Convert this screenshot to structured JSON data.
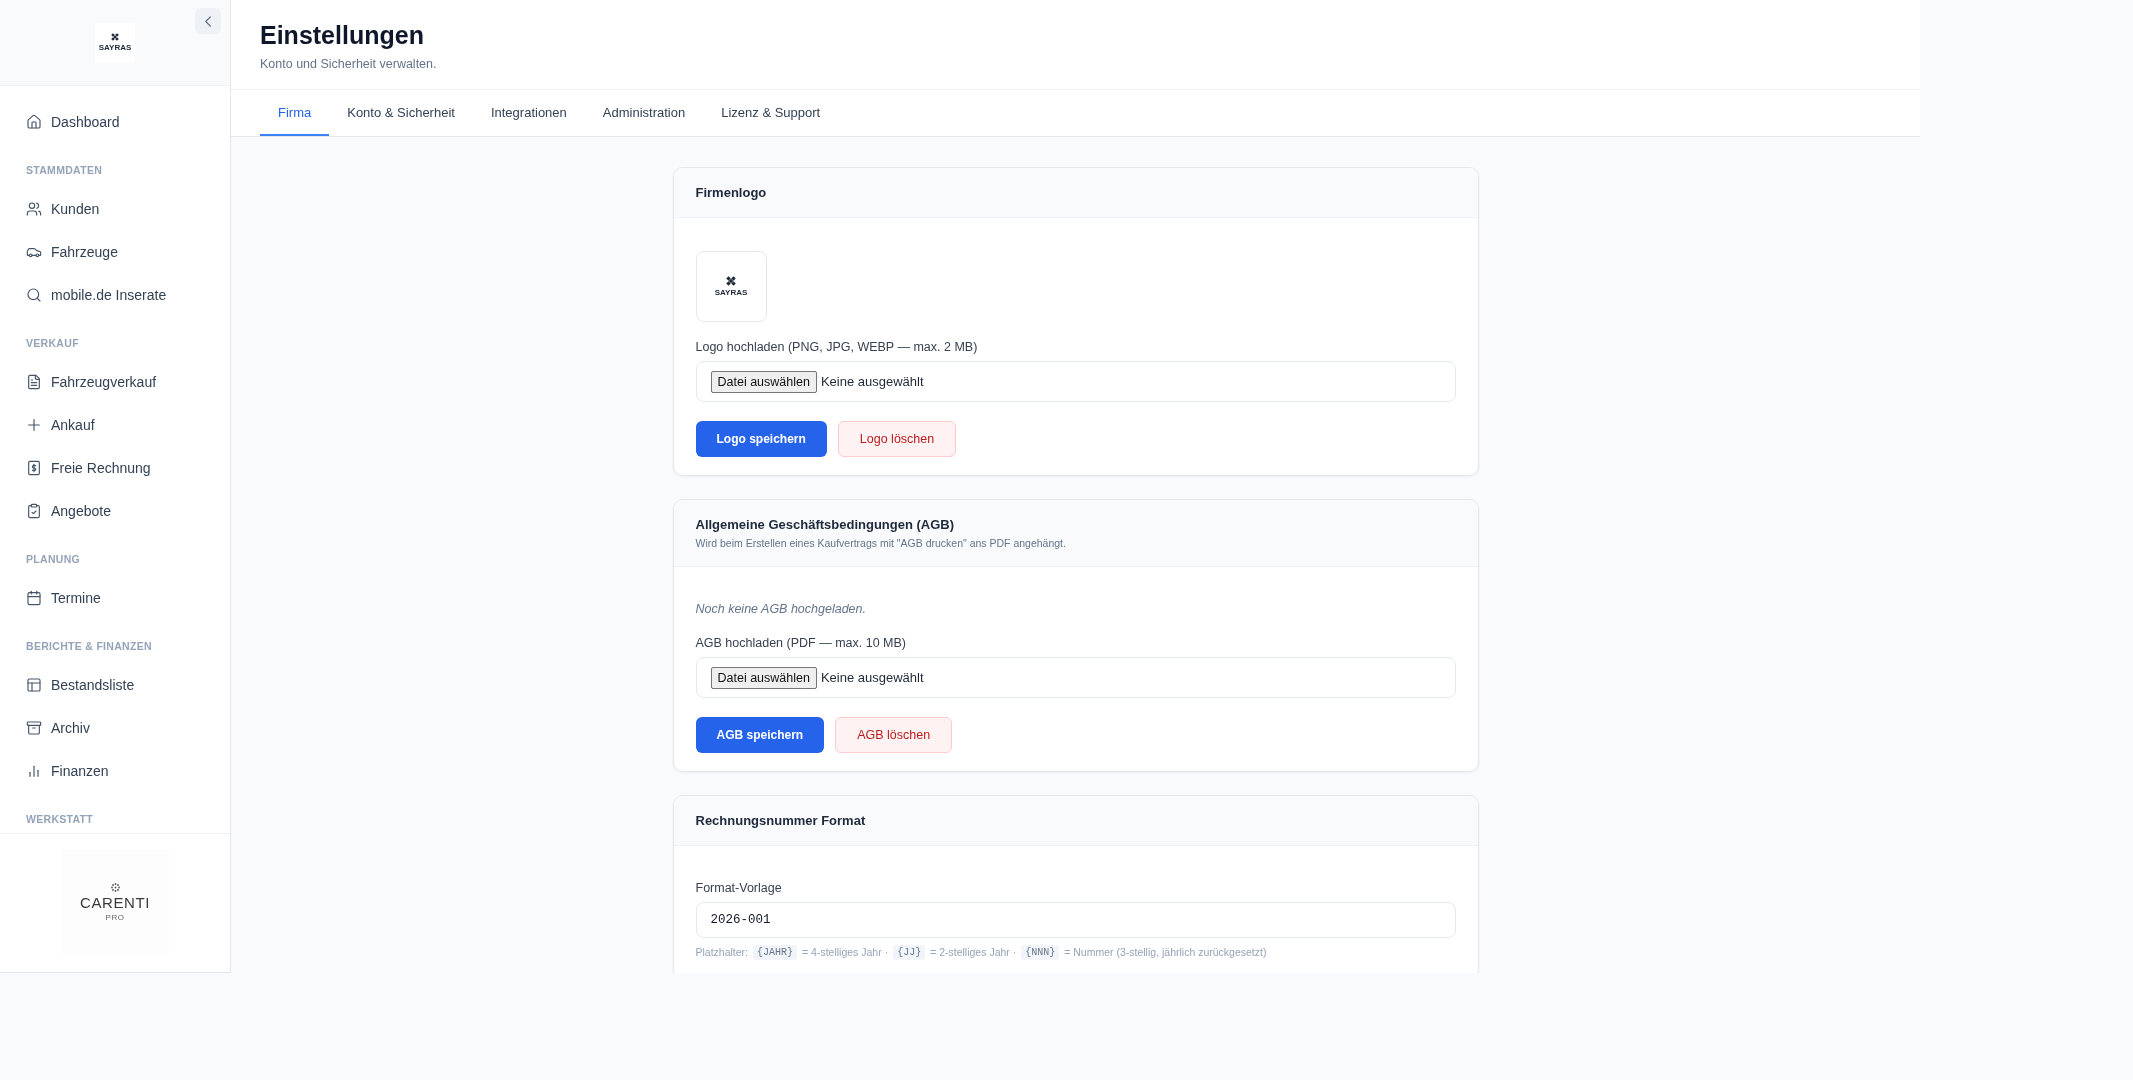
{
  "sidebar": {
    "logo": {
      "name": "SAYRAS"
    },
    "sections": [
      {
        "items": [
          {
            "label": "Dashboard",
            "selected": false
          }
        ]
      },
      {
        "title": "STAMMDATEN",
        "items": [
          {
            "label": "Kunden",
            "selected": false
          },
          {
            "label": "Fahrzeuge",
            "selected": false
          },
          {
            "label": "mobile.de Inserate",
            "selected": false
          }
        ]
      },
      {
        "title": "VERKAUF",
        "items": [
          {
            "label": "Fahrzeugverkauf",
            "selected": false
          },
          {
            "label": "Ankauf",
            "selected": false
          },
          {
            "label": "Freie Rechnung",
            "selected": false
          },
          {
            "label": "Angebote",
            "selected": false
          }
        ]
      },
      {
        "title": "PLANUNG",
        "items": [
          {
            "label": "Termine",
            "selected": false
          }
        ]
      },
      {
        "title": "BERICHTE & FINANZEN",
        "items": [
          {
            "label": "Bestandsliste",
            "selected": false
          },
          {
            "label": "Archiv",
            "selected": false
          },
          {
            "label": "Finanzen",
            "selected": false
          }
        ]
      },
      {
        "title": "WERKSTATT"
      }
    ],
    "footer_logo": {
      "name": "CARENTI",
      "tagline": "PRO"
    }
  },
  "header": {
    "title": "Einstellungen",
    "subtitle": "Konto und Sicherheit verwalten."
  },
  "tabs": [
    {
      "label": "Firma",
      "selected": true
    },
    {
      "label": "Konto & Sicherheit",
      "selected": false
    },
    {
      "label": "Integrationen",
      "selected": false
    },
    {
      "label": "Administration",
      "selected": false
    },
    {
      "label": "Lizenz & Support",
      "selected": false
    }
  ],
  "cards": [
    {
      "title": "Firmenlogo",
      "blocks": [
        {
          "kind": "logo",
          "name": "SAYRAS"
        },
        {
          "kind": "file",
          "label": "Logo hochladen (PNG, JPG, WEBP — max. 2 MB)",
          "button": "Datei auswählen",
          "status": "Keine ausgewählt"
        },
        {
          "kind": "actions",
          "buttons": [
            {
              "kind": "primary",
              "label": "Logo speichern"
            },
            {
              "kind": "danger",
              "label": "Logo löschen"
            }
          ]
        }
      ]
    },
    {
      "title": "Allgemeine Geschäftsbedingungen (AGB)",
      "subtitle": "Wird beim Erstellen eines Kaufvertrags mit \"AGB drucken\" ans PDF angehängt.",
      "blocks": [
        {
          "kind": "note",
          "text": "Noch keine AGB hochgeladen."
        },
        {
          "kind": "file",
          "label": "AGB hochladen (PDF — max. 10 MB)",
          "button": "Datei auswählen",
          "status": "Keine ausgewählt"
        },
        {
          "kind": "actions",
          "buttons": [
            {
              "kind": "primary",
              "label": "AGB speichern"
            },
            {
              "kind": "danger",
              "label": "AGB löschen"
            }
          ]
        }
      ]
    },
    {
      "title": "Rechnungsnummer Format",
      "blocks": [
        {
          "kind": "text",
          "label": "Format-Vorlage",
          "value": "2026-001"
        },
        {
          "kind": "hint",
          "parts": [
            {
              "kind": "text",
              "text": "Platzhalter:"
            },
            {
              "kind": "code",
              "text": "{JAHR}"
            },
            {
              "kind": "text",
              "text": "= 4-stelliges Jahr ·"
            },
            {
              "kind": "code",
              "text": "{JJ}"
            },
            {
              "kind": "text",
              "text": "= 2-stelliges Jahr ·"
            },
            {
              "kind": "code",
              "text": "{NNN}"
            },
            {
              "kind": "text",
              "text": "= Nummer (3-stellig, jährlich zurückgesetzt)"
            }
          ]
        }
      ]
    }
  ]
}
